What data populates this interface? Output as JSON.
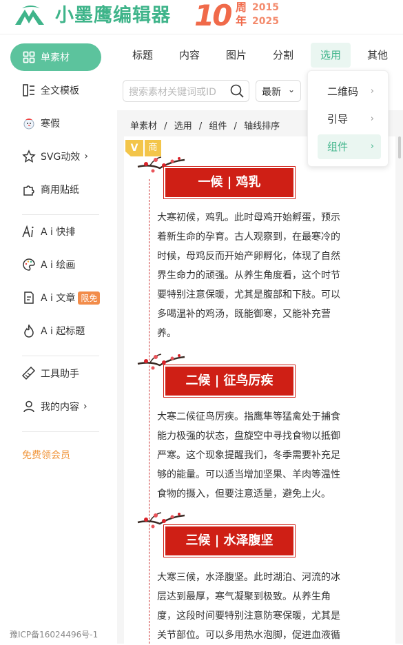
{
  "header": {
    "logo_text": "小墨鹰编辑器",
    "anniversary_number": "10",
    "anniversary_char_1": "周",
    "anniversary_char_2": "年",
    "anniversary_year_1": "2015",
    "anniversary_year_2": "2025"
  },
  "sidebar": {
    "items": [
      {
        "label": "单素材",
        "icon": "grid-icon"
      },
      {
        "label": "全文模板",
        "icon": "template-icon"
      },
      {
        "label": "寒假",
        "icon": "snowman-icon"
      },
      {
        "label": "SVG动效",
        "icon": "star-icon"
      },
      {
        "label": "商用贴纸",
        "icon": "puzzle-icon"
      },
      {
        "label": "A i 快排",
        "icon": "ai-icon"
      },
      {
        "label": "A i 绘画",
        "icon": "palette-icon"
      },
      {
        "label": "A i 文章",
        "icon": "document-icon"
      },
      {
        "label": "A i 起标题",
        "icon": "flame-icon"
      },
      {
        "label": "工具助手",
        "icon": "tool-icon"
      },
      {
        "label": "我的内容",
        "icon": "user-icon"
      }
    ],
    "badge_free": "限免",
    "chevron": "›",
    "vip_link": "免费领会员",
    "icp": "豫ICP备16024496号-1"
  },
  "tabs": [
    "标题",
    "内容",
    "图片",
    "分割",
    "选用",
    "其他"
  ],
  "search": {
    "placeholder": "搜索素材关键词或ID"
  },
  "sort": {
    "label": "最新"
  },
  "dropdown": {
    "items": [
      "二维码",
      "引导",
      "组件"
    ],
    "arrow": "›"
  },
  "breadcrumb": [
    "单素材",
    "/",
    "选用",
    "/",
    "组件",
    "/",
    "轴线排序"
  ],
  "preview": {
    "tag_v": "V",
    "tag_s": "商",
    "sections": [
      {
        "title": "一候 | 鸡乳",
        "lines": [
          "大寒初候，鸡乳。此时母鸡开始孵蛋，预示",
          "着新生命的孕育。古人观察到，在最寒冷的",
          "时候，母鸡反而开始产卵孵化，体现了自然",
          "界生命力的顽强。从养生角度看，这个时节",
          "要特别注意保暖，尤其是腹部和下肢。可以",
          "多喝温补的鸡汤，既能御寒，又能补充营",
          "养。"
        ]
      },
      {
        "title": "二候 | 征鸟厉疾",
        "lines": [
          "大寒二候征鸟厉疾。指鹰隼等猛禽处于捕食",
          "能力极强的状态，盘旋空中寻找食物以抵御",
          "严寒。这个现象提醒我们，冬季需要补充足",
          "够的能量。可以适当增加坚果、羊肉等温性",
          "食物的摄入，但要注意适量，避免上火。"
        ]
      },
      {
        "title": "三候 | 水泽腹坚",
        "lines": [
          "大寒三候，水泽腹坚。此时湖泊、河流的冰",
          "层达到最厚，寒气凝聚到极致。从养生角",
          "度，这段时间要特别注意防寒保暖，尤其是",
          "关节部位。可以多用热水泡脚，促进血液循"
        ]
      }
    ]
  },
  "colors": {
    "brand_green": "#3fb48a",
    "active_sidebar": "#5cc39d",
    "title_red": "#cf1f15",
    "anniversary_orange": "#f06a4a"
  }
}
